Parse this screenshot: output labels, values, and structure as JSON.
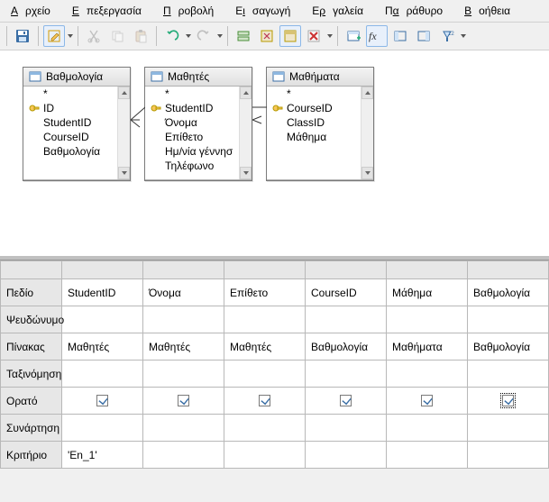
{
  "menu": {
    "file": "Αρχείο",
    "edit": "Επεξεργασία",
    "view": "Προβολή",
    "insert": "Εισαγωγή",
    "tools": "Εργαλεία",
    "window": "Παράθυρο",
    "help": "Βοήθεια"
  },
  "tables": {
    "t1": {
      "title": "Βαθμολογία",
      "fields": {
        "f0": "*",
        "f1": "ID",
        "f2": "StudentID",
        "f3": "CourseID",
        "f4": "Βαθμολογία"
      }
    },
    "t2": {
      "title": "Μαθητές",
      "fields": {
        "f0": "*",
        "f1": "StudentID",
        "f2": "Όνομα",
        "f3": "Επίθετο",
        "f4": "Ημ/νία γέννησ",
        "f5": "Τηλέφωνο"
      }
    },
    "t3": {
      "title": "Μαθήματα",
      "fields": {
        "f0": "*",
        "f1": "CourseID",
        "f2": "ClassID",
        "f3": "Μάθημα"
      }
    }
  },
  "grid": {
    "rownames": {
      "field": "Πεδίο",
      "alias": "Ψευδώνυμο",
      "table": "Πίνακας",
      "sort": "Ταξινόμηση",
      "visible": "Ορατό",
      "function": "Συνάρτηση",
      "criteria": "Κριτήριο"
    },
    "cols": [
      {
        "field": "StudentID",
        "table": "Μαθητές",
        "criteria": "'En_1'"
      },
      {
        "field": "Όνομα",
        "table": "Μαθητές",
        "criteria": ""
      },
      {
        "field": "Επίθετο",
        "table": "Μαθητές",
        "criteria": ""
      },
      {
        "field": "CourseID",
        "table": "Βαθμολογία",
        "criteria": ""
      },
      {
        "field": "Μάθημα",
        "table": "Μαθήματα",
        "criteria": ""
      },
      {
        "field": "Βαθμολογία",
        "table": "Βαθμολογία",
        "criteria": ""
      }
    ]
  }
}
